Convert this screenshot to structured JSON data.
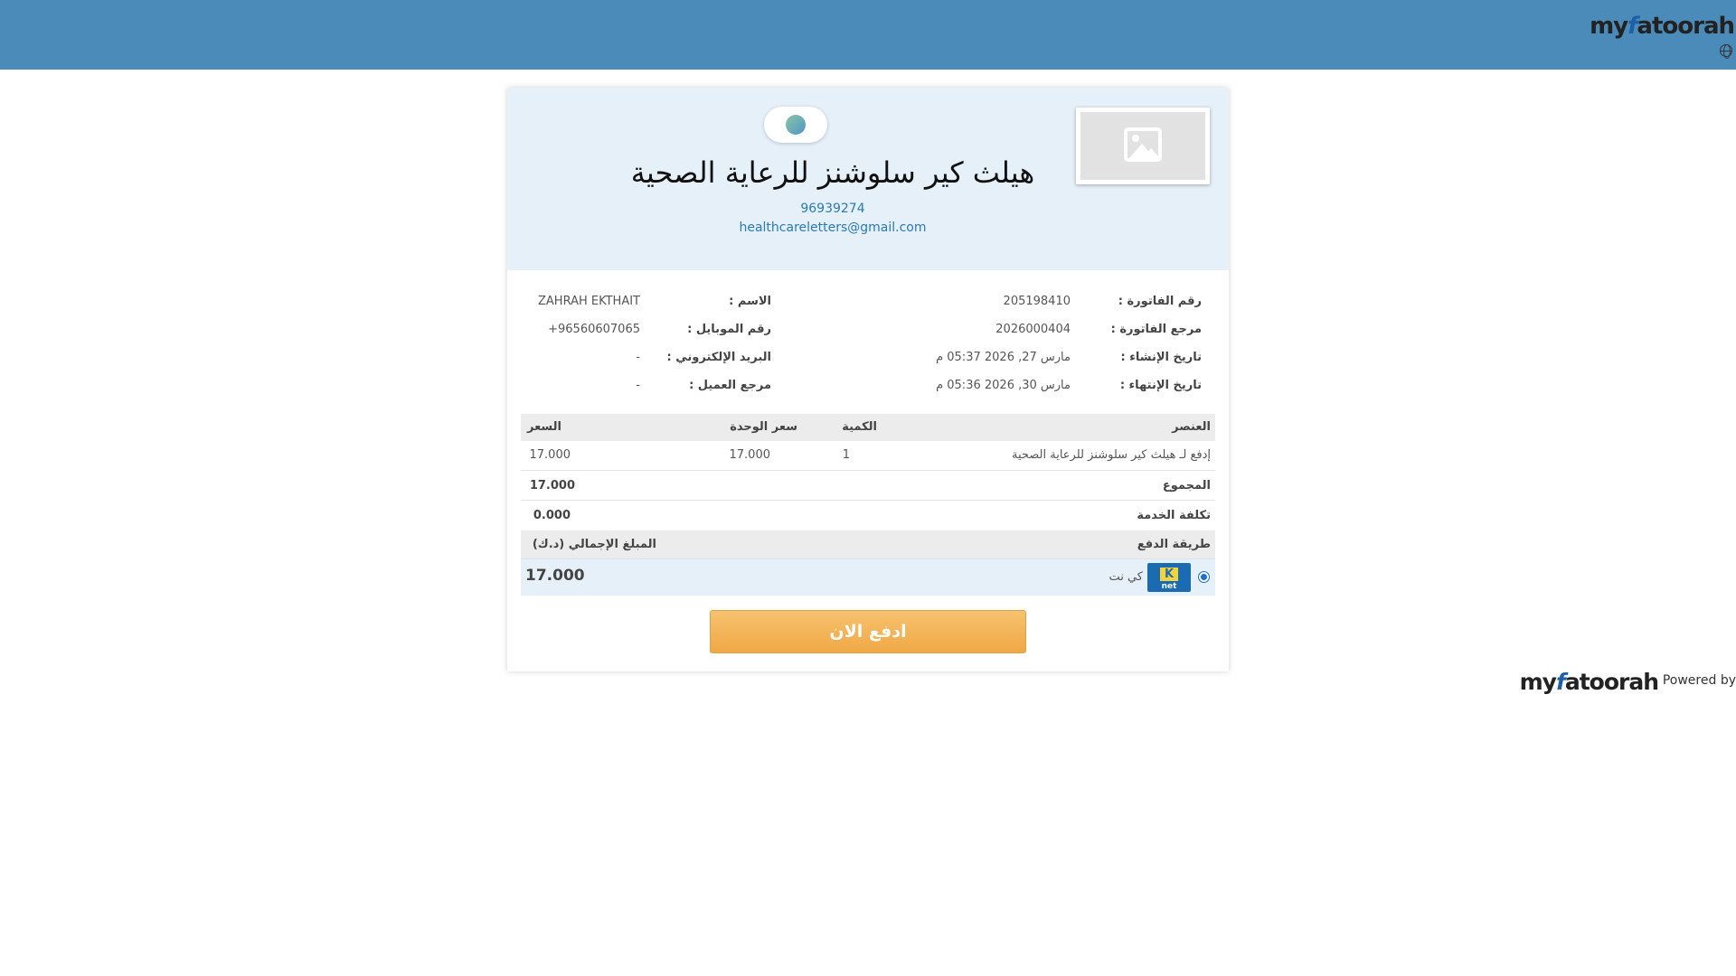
{
  "header": {
    "brand_prefix": "my",
    "brand_mark": "f",
    "brand_suffix": "atoorah",
    "language_icon": "globe-icon"
  },
  "merchant": {
    "name": "هيلث كير سلوشنز للرعاية الصحية",
    "phone": "96939274",
    "email": "healthcareletters@gmail.com",
    "logo_icon": "image-placeholder-icon",
    "theme_toggle_icon": "theme-toggle-icon"
  },
  "invoice": {
    "number_label": "رقم الفاتورة :",
    "number_value": "205198410",
    "reference_label": "مرجع الفاتورة :",
    "reference_value": "2026000404",
    "created_label": "تاريخ الإنشاء :",
    "created_value": "مارس 27, 2026 05:37 م",
    "expiry_label": "تاريخ الإنتهاء :",
    "expiry_value": "مارس 30, 2026 05:36 م"
  },
  "customer": {
    "name_label": "الاسم :",
    "name_value": "ZAHRAH EKTHAIT",
    "mobile_label": "رقم الموبايل :",
    "mobile_value": "+96560607065",
    "email_label": "البريد الإلكتروني :",
    "email_value": "-",
    "reference_label": "مرجع العميل :",
    "reference_value": "-"
  },
  "table": {
    "headers": {
      "item": "العنصر",
      "quantity": "الكمية",
      "unit_price": "سعر الوحدة",
      "price": "السعر"
    },
    "rows": [
      {
        "item": "إدفع لـ هيلث كير سلوشنز للرعاية الصحية",
        "quantity": "1",
        "unit_price": "17.000",
        "price": "17.000"
      }
    ],
    "subtotal_label": "المجموع",
    "subtotal_value": "17.000",
    "service_fee_label": "تكلفة الخدمة",
    "service_fee_value": "0.000"
  },
  "payment": {
    "method_label": "طريقة الدفع",
    "total_label": "المبلغ الإجمالي (د.ك)",
    "method_name": "كي نت",
    "knet_logo_letter": "K",
    "knet_logo_word": "net",
    "total_value": "17.000",
    "pay_button": "ادفع الان"
  },
  "footer": {
    "powered_by": "Powered by",
    "brand_prefix": "my",
    "brand_mark": "f",
    "brand_suffix": "atoorah"
  },
  "colors": {
    "topbar": "#4a8bb9",
    "accent_link": "#2a7ab3",
    "pay_button": "#f0a845",
    "header_panel": "#e6f0f9"
  }
}
